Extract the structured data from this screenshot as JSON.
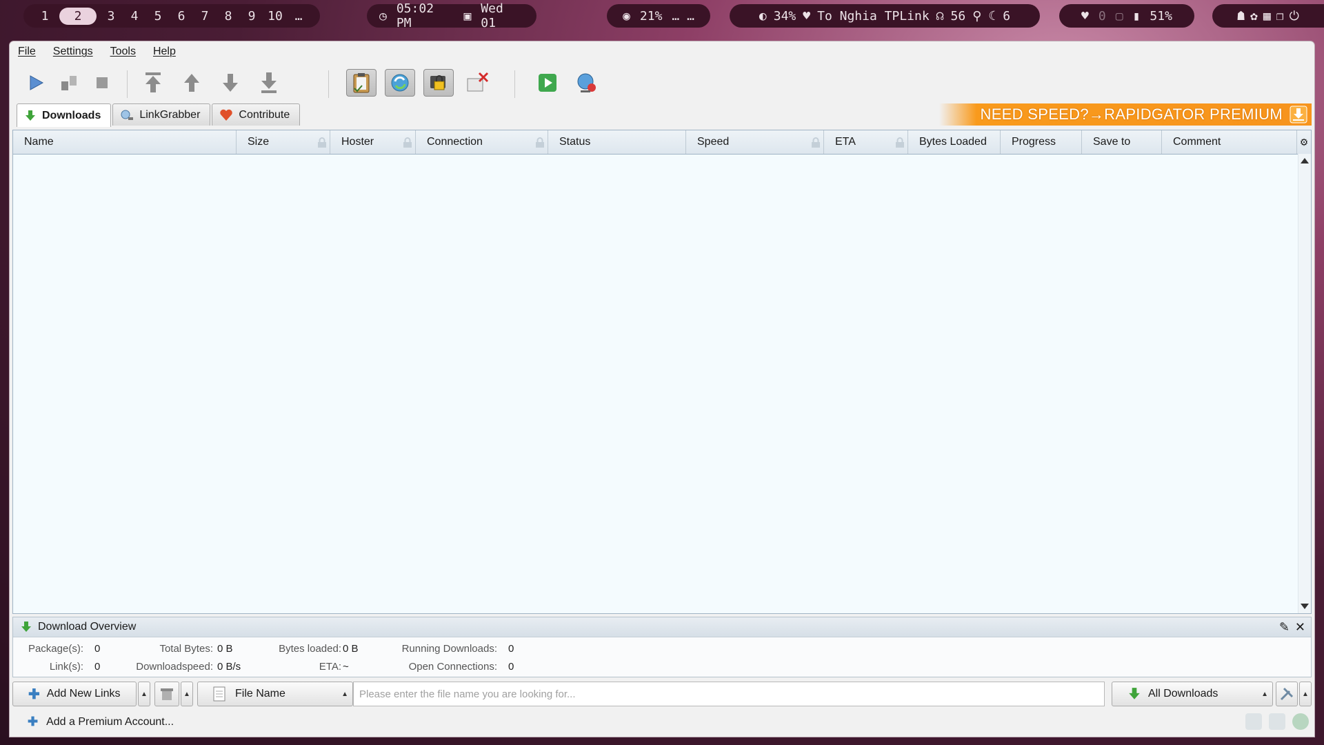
{
  "statusbar": {
    "workspaces": [
      "1",
      "2",
      "3",
      "4",
      "5",
      "6",
      "7",
      "8",
      "9",
      "10",
      "…"
    ],
    "active_workspace": "2",
    "time": "05:02 PM",
    "date": "Wed 01",
    "cpu": "21%",
    "cpu_extra": "… …",
    "brightness": "34%",
    "wifi": "To Nghia TPLink",
    "headphones": "56",
    "mic_value": "6",
    "dim_value": "0",
    "battery": "51%"
  },
  "menu": [
    "File",
    "Settings",
    "Tools",
    "Help"
  ],
  "tabs": {
    "downloads": "Downloads",
    "linkgrabber": "LinkGrabber",
    "contribute": "Contribute"
  },
  "banner": "NEED SPEED?→RAPIDGATOR PREMIUM",
  "columns": [
    "Name",
    "Size",
    "Hoster",
    "Connection",
    "Status",
    "Speed",
    "ETA",
    "Bytes Loaded",
    "Progress",
    "Save to",
    "Comment"
  ],
  "overview": {
    "title": "Download Overview",
    "packages_label": "Package(s):",
    "packages": "0",
    "links_label": "Link(s):",
    "links": "0",
    "total_bytes_label": "Total Bytes:",
    "total_bytes": "0 B",
    "downloadspeed_label": "Downloadspeed:",
    "downloadspeed": "0 B/s",
    "bytes_loaded_label": "Bytes loaded:",
    "bytes_loaded": "0 B",
    "eta_label": "ETA:",
    "eta": "~",
    "running_label": "Running Downloads:",
    "running": "0",
    "open_conn_label": "Open Connections:",
    "open_conn": "0"
  },
  "bottom": {
    "add_links": "Add New Links",
    "search_field": "File Name",
    "search_placeholder": "Please enter the file name you are looking for...",
    "filter": "All Downloads"
  },
  "premium": "Add a Premium Account..."
}
